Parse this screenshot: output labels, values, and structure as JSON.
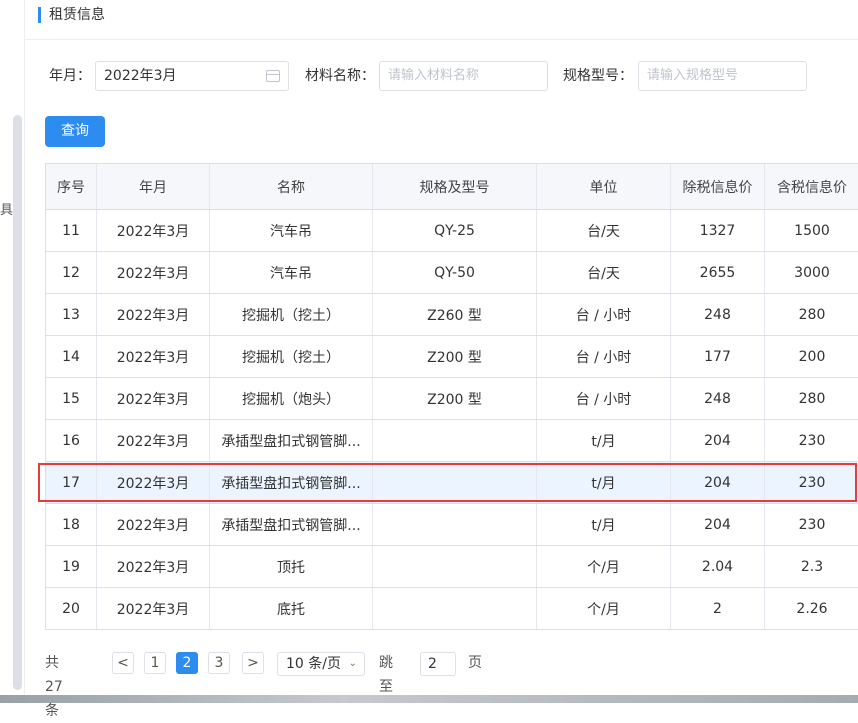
{
  "side": {
    "fragment_char": "具"
  },
  "section": {
    "title": "租赁信息"
  },
  "filters": {
    "month_label": "年月：",
    "month_value": "2022年3月",
    "material_label": "材料名称：",
    "material_placeholder": "请输入材料名称",
    "spec_label": "规格型号：",
    "spec_placeholder": "请输入规格型号",
    "query_button": "查询"
  },
  "table": {
    "headers": [
      "序号",
      "年月",
      "名称",
      "规格及型号",
      "单位",
      "除税信息价",
      "含税信息价"
    ],
    "rows": [
      [
        "11",
        "2022年3月",
        "汽车吊",
        "QY-25",
        "台/天",
        "1327",
        "1500"
      ],
      [
        "12",
        "2022年3月",
        "汽车吊",
        "QY-50",
        "台/天",
        "2655",
        "3000"
      ],
      [
        "13",
        "2022年3月",
        "挖掘机（挖土）",
        "Z260 型",
        "台 / 小时",
        "248",
        "280"
      ],
      [
        "14",
        "2022年3月",
        "挖掘机（挖土）",
        "Z200 型",
        "台 / 小时",
        "177",
        "200"
      ],
      [
        "15",
        "2022年3月",
        "挖掘机（炮头）",
        "Z200 型",
        "台 / 小时",
        "248",
        "280"
      ],
      [
        "16",
        "2022年3月",
        "承插型盘扣式钢管脚...",
        "",
        "t/月",
        "204",
        "230"
      ],
      [
        "17",
        "2022年3月",
        "承插型盘扣式钢管脚...",
        "",
        "t/月",
        "204",
        "230"
      ],
      [
        "18",
        "2022年3月",
        "承插型盘扣式钢管脚...",
        "",
        "t/月",
        "204",
        "230"
      ],
      [
        "19",
        "2022年3月",
        "顶托",
        "",
        "个/月",
        "2.04",
        "2.3"
      ],
      [
        "20",
        "2022年3月",
        "底托",
        "",
        "个/月",
        "2",
        "2.26"
      ]
    ],
    "selected_index": 6
  },
  "pagination": {
    "total_text": "共 27 条",
    "prev": "<",
    "pages": [
      "1",
      "2",
      "3"
    ],
    "current_page": "2",
    "next": ">",
    "page_size": "10 条/页",
    "jump_label": "跳至",
    "jump_value": "2",
    "page_suffix": "页"
  },
  "colors": {
    "accent": "#2d8cf0",
    "highlight_border": "#e63b3b",
    "selected_row": "#ecf5ff"
  }
}
